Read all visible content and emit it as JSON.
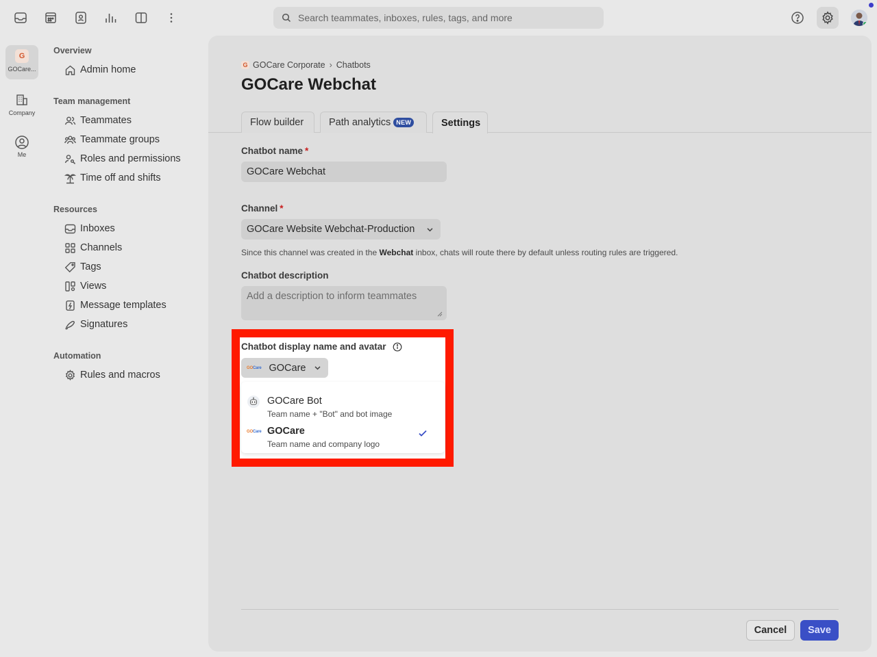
{
  "topbar": {
    "search_placeholder": "Search teammates, inboxes, rules, tags, and more"
  },
  "rail": {
    "org_initial": "G",
    "org_label": "GOCare...",
    "company_label": "Company",
    "me_label": "Me"
  },
  "nav": {
    "overview": {
      "heading": "Overview",
      "items": [
        "Admin home"
      ]
    },
    "team": {
      "heading": "Team management",
      "items": [
        "Teammates",
        "Teammate groups",
        "Roles and permissions",
        "Time off and shifts"
      ]
    },
    "resources": {
      "heading": "Resources",
      "items": [
        "Inboxes",
        "Channels",
        "Tags",
        "Views",
        "Message templates",
        "Signatures"
      ]
    },
    "automation": {
      "heading": "Automation",
      "items": [
        "Rules and macros"
      ]
    }
  },
  "breadcrumb": {
    "org_initial": "G",
    "org": "GOCare Corporate",
    "section": "Chatbots"
  },
  "page_title": "GOCare Webchat",
  "tabs": [
    {
      "label": "Flow builder"
    },
    {
      "label": "Path analytics",
      "badge": "NEW"
    },
    {
      "label": "Settings"
    }
  ],
  "form": {
    "name_label": "Chatbot name",
    "name_value": "GOCare Webchat",
    "channel_label": "Channel",
    "channel_value": "GOCare Website Webchat-Production",
    "channel_help_pre": "Since this channel was created in the ",
    "channel_help_bold": "Webchat",
    "channel_help_post": " inbox, chats will route there by default unless routing rules are triggered.",
    "description_label": "Chatbot description",
    "description_placeholder": "Add a description to inform teammates",
    "display_label": "Chatbot display name and avatar",
    "display_value": "GOCare",
    "logo_text_a": "GO",
    "logo_text_b": "Care",
    "options": [
      {
        "title": "GOCare Bot",
        "subtitle": "Team name + \"Bot\" and bot image"
      },
      {
        "title": "GOCare",
        "subtitle": "Team name and company logo"
      }
    ]
  },
  "footer": {
    "cancel": "Cancel",
    "save": "Save"
  },
  "colors": {
    "accent": "#3a4fc6",
    "highlight": "#ff1a00",
    "required": "#c81e1e",
    "new_badge": "#2f4ea0"
  }
}
